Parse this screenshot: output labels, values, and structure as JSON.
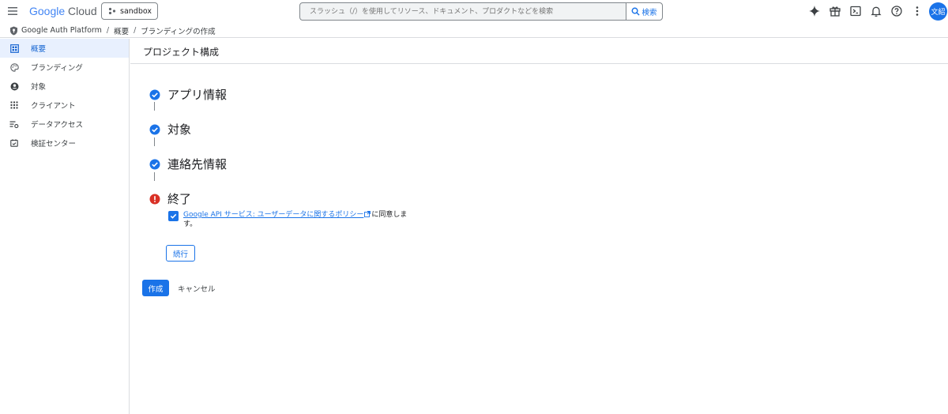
{
  "header": {
    "logo_google": "Google",
    "logo_cloud": "Cloud",
    "project_name": "sandbox",
    "search_placeholder": "スラッシュ（/）を使用してリソース、ドキュメント、プロダクトなどを検索",
    "search_button": "検索",
    "avatar_initials": "文紹"
  },
  "breadcrumb": {
    "items": [
      "Google Auth Platform",
      "概要",
      "ブランディングの作成"
    ],
    "separator": "/"
  },
  "sidebar": {
    "items": [
      {
        "label": "概要",
        "icon": "dashboard-icon",
        "active": true
      },
      {
        "label": "ブランディング",
        "icon": "palette-icon",
        "active": false
      },
      {
        "label": "対象",
        "icon": "account-circle-icon",
        "active": false
      },
      {
        "label": "クライアント",
        "icon": "grid-icon",
        "active": false
      },
      {
        "label": "データアクセス",
        "icon": "data-access-icon",
        "active": false
      },
      {
        "label": "検証センター",
        "icon": "verification-icon",
        "active": false
      }
    ]
  },
  "main": {
    "title": "プロジェクト構成",
    "steps": [
      {
        "label": "アプリ情報",
        "status": "complete"
      },
      {
        "label": "対象",
        "status": "complete"
      },
      {
        "label": "連絡先情報",
        "status": "complete"
      },
      {
        "label": "終了",
        "status": "error"
      }
    ],
    "agreement": {
      "checked": true,
      "link_text": "Google API サービス: ユーザーデータに関するポリシー",
      "suffix": "に同意します。"
    },
    "continue_label": "続行",
    "create_label": "作成",
    "cancel_label": "キャンセル"
  },
  "colors": {
    "accent": "#1a73e8",
    "error": "#d93025",
    "active_bg": "#e8f0fe"
  }
}
